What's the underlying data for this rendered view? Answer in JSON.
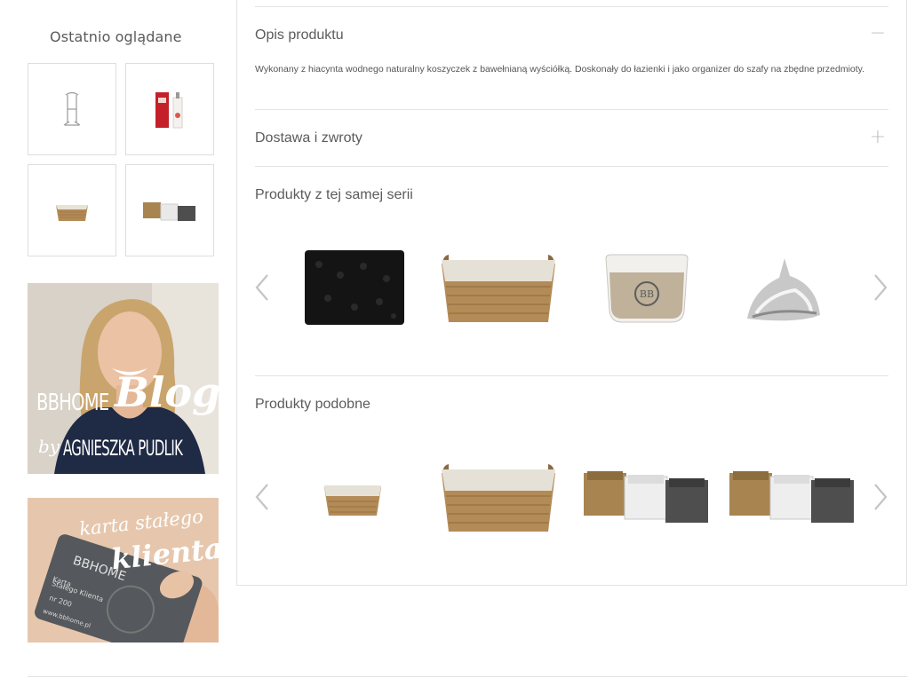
{
  "sidebar": {
    "recent_title": "Ostatnio oglądane",
    "recent_items": [
      {
        "icon": "clothes-rack-icon"
      },
      {
        "icon": "diffuser-bottle-icon"
      },
      {
        "icon": "wicker-basket-icon"
      },
      {
        "icon": "basket-set-icon"
      }
    ],
    "blog_banner": {
      "brand": "BBHOME",
      "script": "Blog",
      "byline_by": "by",
      "byline_name": "AGNIESZKA PUDLIK"
    },
    "card_banner": {
      "line1": "karta stałego",
      "line2": "klienta",
      "card_brand": "BBHOME",
      "card_text_1": "Karta",
      "card_text_2": "Stałego Klienta",
      "card_text_3": "nr 200",
      "card_url": "www.bbhome.pl"
    }
  },
  "main": {
    "description": {
      "title": "Opis produktu",
      "toggle": "−",
      "text": "Wykonany z hiacynta wodnego naturalny koszyczek z bawełnianą wyściółką. Doskonały do łazienki i jako organizer do szafy na zbędne przedmioty."
    },
    "shipping": {
      "title": "Dostawa i zwroty",
      "toggle": "+"
    },
    "same_series": {
      "title": "Produkty z tej samej serii",
      "items": [
        "black-rug",
        "lined-wicker-basket",
        "candle-glass",
        "silver-shell"
      ]
    },
    "similar": {
      "title": "Produkty podobne",
      "items": [
        "small-wicker-basket",
        "lined-wicker-basket-large",
        "basket-trio",
        "basket-trio"
      ]
    }
  },
  "colors": {
    "text": "#5b5b5b",
    "border": "#e3e3e3",
    "wicker": "#b38b57",
    "candle_red": "#c4202a"
  }
}
